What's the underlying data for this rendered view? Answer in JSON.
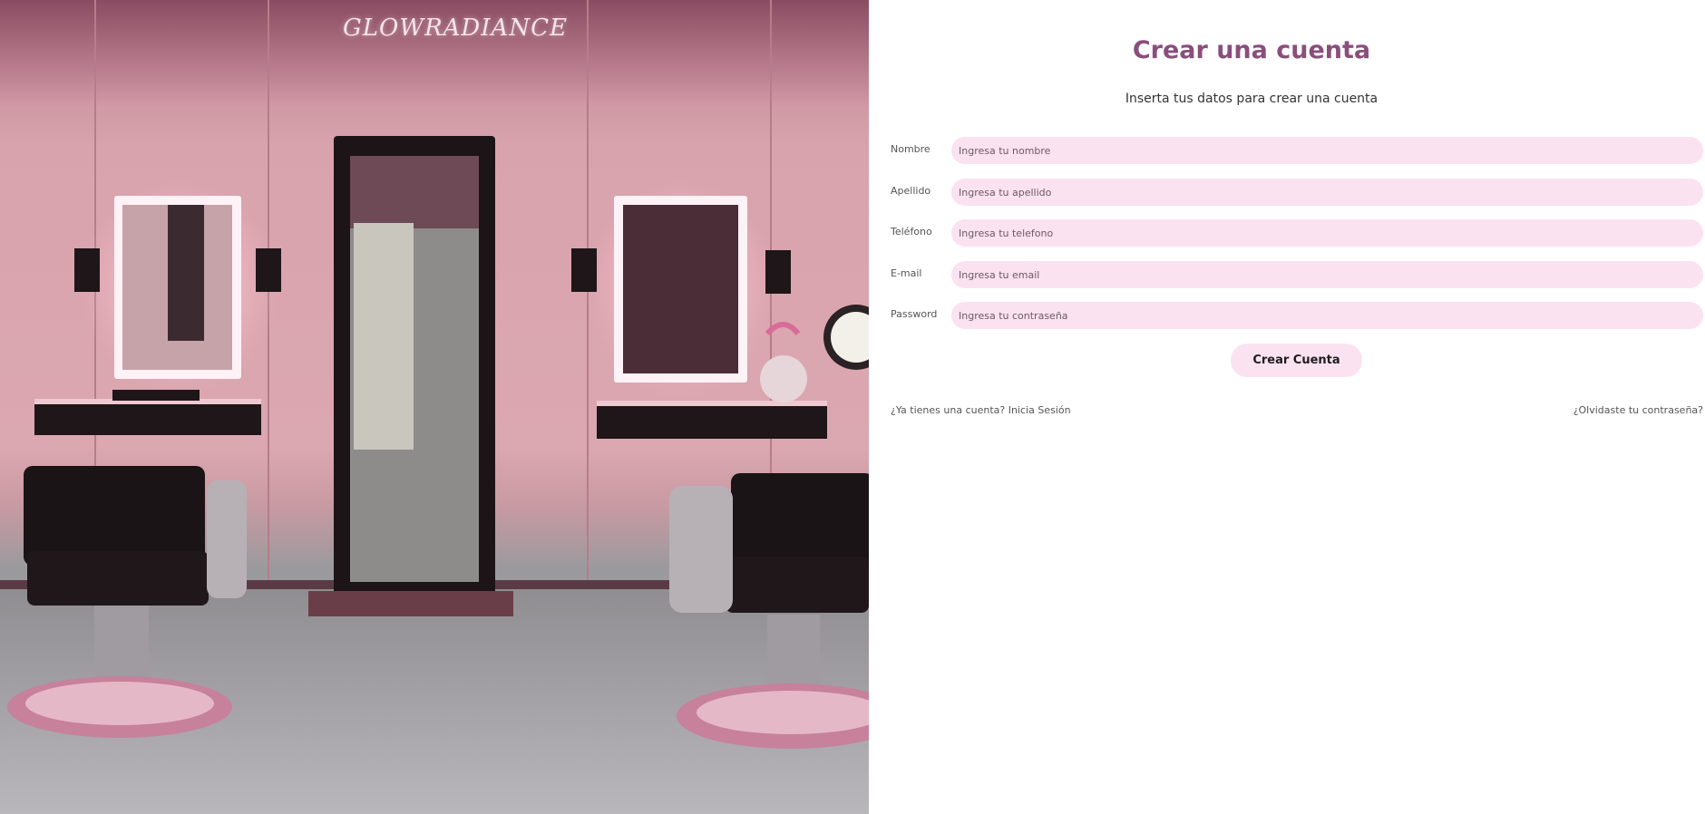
{
  "brand": {
    "logo_text": "GLOWRADIANCE"
  },
  "hero": {
    "image_alt": "Pink beauty salon interior with mirrors and styling chairs"
  },
  "form": {
    "title": "Crear una cuenta",
    "subtitle": "Inserta tus datos para crear una cuenta",
    "fields": [
      {
        "label": "Nombre",
        "placeholder": "Ingresa tu nombre",
        "value": ""
      },
      {
        "label": "Apellido",
        "placeholder": "Ingresa tu apellido",
        "value": ""
      },
      {
        "label": "Teléfono",
        "placeholder": "Ingresa tu telefono",
        "value": ""
      },
      {
        "label": "E-mail",
        "placeholder": "Ingresa tu email",
        "value": ""
      },
      {
        "label": "Password",
        "placeholder": "Ingresa tu contraseña",
        "value": ""
      }
    ],
    "submit_label": "Crear Cuenta",
    "login_link": "¿Ya tienes una cuenta? Inicia Sesión",
    "forgot_link": "¿Olvidaste tu contraseña?"
  },
  "colors": {
    "accent": "#8a4e7c",
    "input_bg": "#fbe2f1",
    "button_bg": "#fbe2f1"
  }
}
